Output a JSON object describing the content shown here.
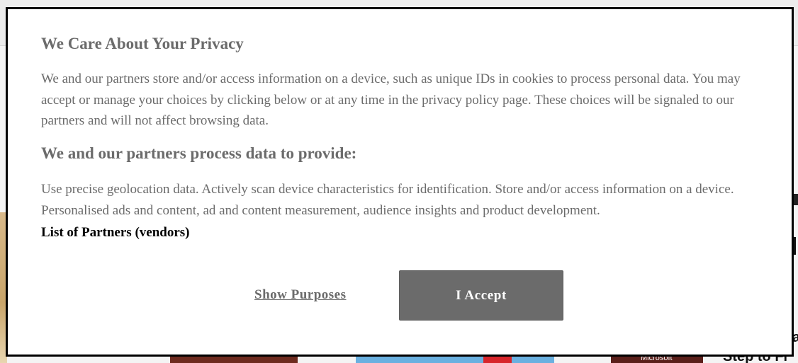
{
  "consent": {
    "title": "We Care About Your Privacy",
    "body": "We and our partners store and/or access information on a device, such as unique IDs in cookies to process personal data. You may accept or manage your choices by clicking below or at any time in the privacy policy page. These choices will be signaled to our partners and will not affect browsing data.",
    "subtitle": "We and our partners process data to provide:",
    "purposes": "Use precise geolocation data. Actively scan device characteristics for identification. Store and/or access information on a device. Personalised ads and content, ad and content measurement, audience insights and product development.",
    "vendors_link": "List of Partners (vendors)",
    "show_purposes_label": "Show Purposes",
    "accept_label": "I Accept"
  },
  "background": {
    "thumb_caption": "Microsoft",
    "headline_fragment": "Step to Fi",
    "side_char_1": "l",
    "side_char_2": "a"
  },
  "colors": {
    "text_gray": "#6b6b6b",
    "accept_bg": "#6b6b6b",
    "dialog_border": "#000000"
  }
}
